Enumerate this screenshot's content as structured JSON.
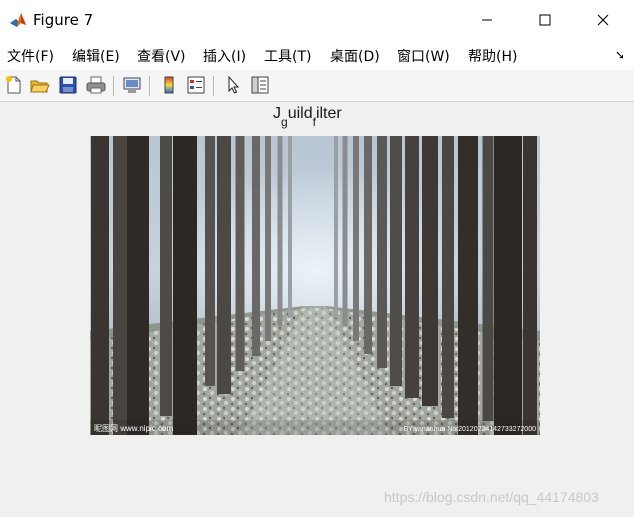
{
  "window": {
    "title": "Figure 7"
  },
  "menu": {
    "items": [
      "文件(F)",
      "编辑(E)",
      "查看(V)",
      "插入(I)",
      "工具(T)",
      "桌面(D)",
      "窗口(W)",
      "帮助(H)"
    ]
  },
  "toolbar": {
    "tools": [
      "new-figure-icon",
      "open-folder-icon",
      "save-icon",
      "print-icon",
      "link-plot-icon",
      "colorbar-icon",
      "legend-icon",
      "pointer-icon",
      "property-editor-icon"
    ]
  },
  "axes": {
    "title_main": "J",
    "title_sub1": "g",
    "title_mid": "uild",
    "title_sub2": "f",
    "title_end": "ilter"
  },
  "image": {
    "caption_left": "昵图网 www.nipic.com",
    "caption_right": "BY:yanaohua  No:20120224142733272000"
  },
  "watermark": "https://blog.csdn.net/qq_44174803"
}
